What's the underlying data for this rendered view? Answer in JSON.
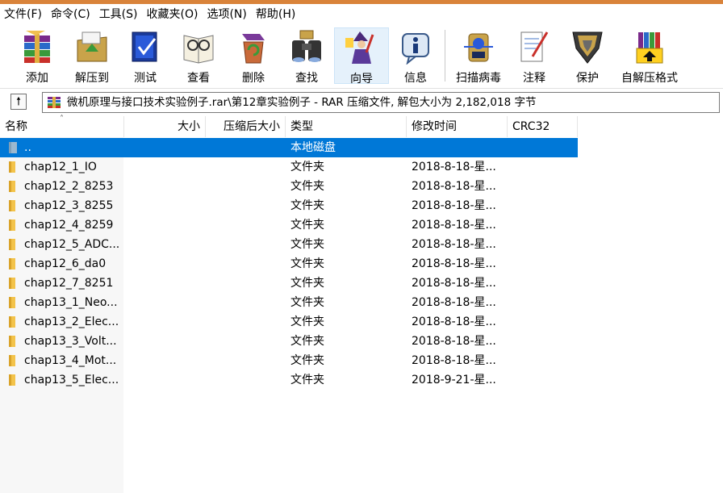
{
  "menu": [
    "文件(F)",
    "命令(C)",
    "工具(S)",
    "收藏夹(O)",
    "选项(N)",
    "帮助(H)"
  ],
  "toolbar": [
    {
      "label": "添加",
      "icon": "add-archive-icon"
    },
    {
      "label": "解压到",
      "icon": "extract-to-icon"
    },
    {
      "label": "测试",
      "icon": "test-archive-icon"
    },
    {
      "label": "查看",
      "icon": "view-icon"
    },
    {
      "label": "删除",
      "icon": "delete-icon"
    },
    {
      "label": "查找",
      "icon": "find-icon"
    },
    {
      "label": "向导",
      "icon": "wizard-icon"
    },
    {
      "label": "信息",
      "icon": "info-icon"
    },
    {
      "label": "扫描病毒",
      "icon": "virus-scan-icon"
    },
    {
      "label": "注释",
      "icon": "comment-icon"
    },
    {
      "label": "保护",
      "icon": "protect-icon"
    },
    {
      "label": "自解压格式",
      "icon": "sfx-icon"
    }
  ],
  "address": {
    "up_icon": "up-folder-icon",
    "path": "微机原理与接口技术实验例子.rar\\第12章实验例子 - RAR 压缩文件, 解包大小为 2,182,018 字节"
  },
  "columns": {
    "name": "名称",
    "size": "大小",
    "packed": "压缩后大小",
    "type": "类型",
    "modified": "修改时间",
    "crc": "CRC32"
  },
  "rows": [
    {
      "name": "..",
      "type": "本地磁盘",
      "date": ""
    },
    {
      "name": "chap12_1_IO",
      "type": "文件夹",
      "date": "2018-8-18-星..."
    },
    {
      "name": "chap12_2_8253",
      "type": "文件夹",
      "date": "2018-8-18-星..."
    },
    {
      "name": "chap12_3_8255",
      "type": "文件夹",
      "date": "2018-8-18-星..."
    },
    {
      "name": "chap12_4_8259",
      "type": "文件夹",
      "date": "2018-8-18-星..."
    },
    {
      "name": "chap12_5_ADC...",
      "type": "文件夹",
      "date": "2018-8-18-星..."
    },
    {
      "name": "chap12_6_da0",
      "type": "文件夹",
      "date": "2018-8-18-星..."
    },
    {
      "name": "chap12_7_8251",
      "type": "文件夹",
      "date": "2018-8-18-星..."
    },
    {
      "name": "chap13_1_Neo...",
      "type": "文件夹",
      "date": "2018-8-18-星..."
    },
    {
      "name": "chap13_2_Elec...",
      "type": "文件夹",
      "date": "2018-8-18-星..."
    },
    {
      "name": "chap13_3_Volt...",
      "type": "文件夹",
      "date": "2018-8-18-星..."
    },
    {
      "name": "chap13_4_Mot...",
      "type": "文件夹",
      "date": "2018-8-18-星..."
    },
    {
      "name": "chap13_5_Elec...",
      "type": "文件夹",
      "date": "2018-9-21-星..."
    }
  ],
  "colors": {
    "accent_strip": "#d9833a",
    "selection": "#0078d7",
    "folder": "#f3c34a"
  }
}
